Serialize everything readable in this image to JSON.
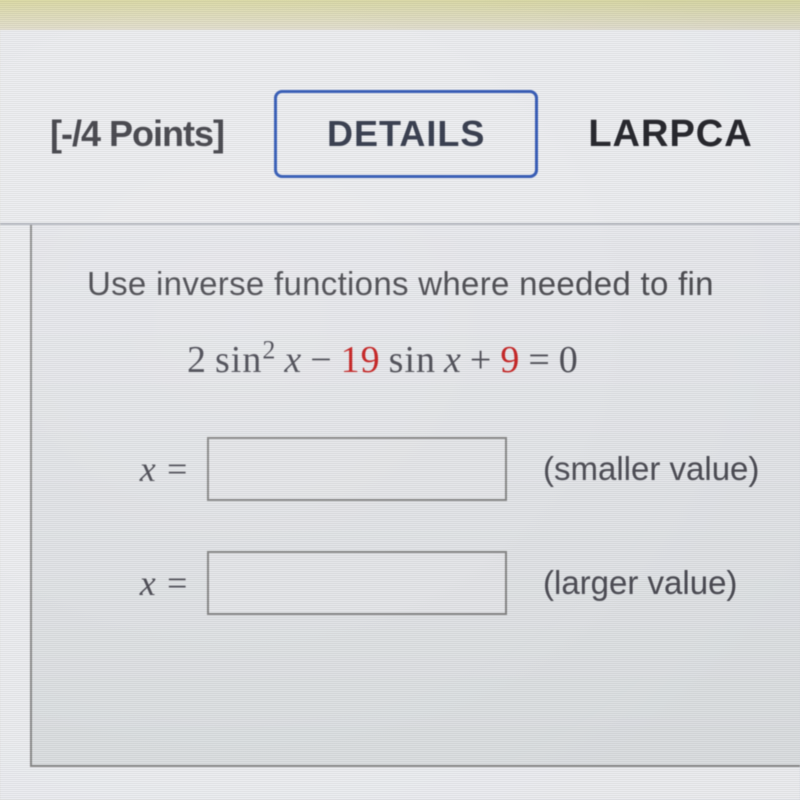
{
  "header": {
    "points_label": "[-/4 Points]",
    "details_button": "DETAILS",
    "source_label": "LARPCA"
  },
  "question": {
    "instruction": "Use inverse functions where needed to fin",
    "equation": {
      "coef1": "2",
      "sin_sq": "sin",
      "exp": "2",
      "var1": "x",
      "minus": "−",
      "coef2": "19",
      "sin2": "sin",
      "var2": "x",
      "plus": "+",
      "coef3": "9",
      "eq": "=",
      "rhs": "0"
    }
  },
  "answers": {
    "x_label": "x =",
    "smaller": {
      "value": "",
      "label": "(smaller value)"
    },
    "larger": {
      "value": "",
      "label": "(larger value)"
    }
  },
  "colors": {
    "accent_blue": "#3a5fb8",
    "accent_red": "#c62828"
  }
}
